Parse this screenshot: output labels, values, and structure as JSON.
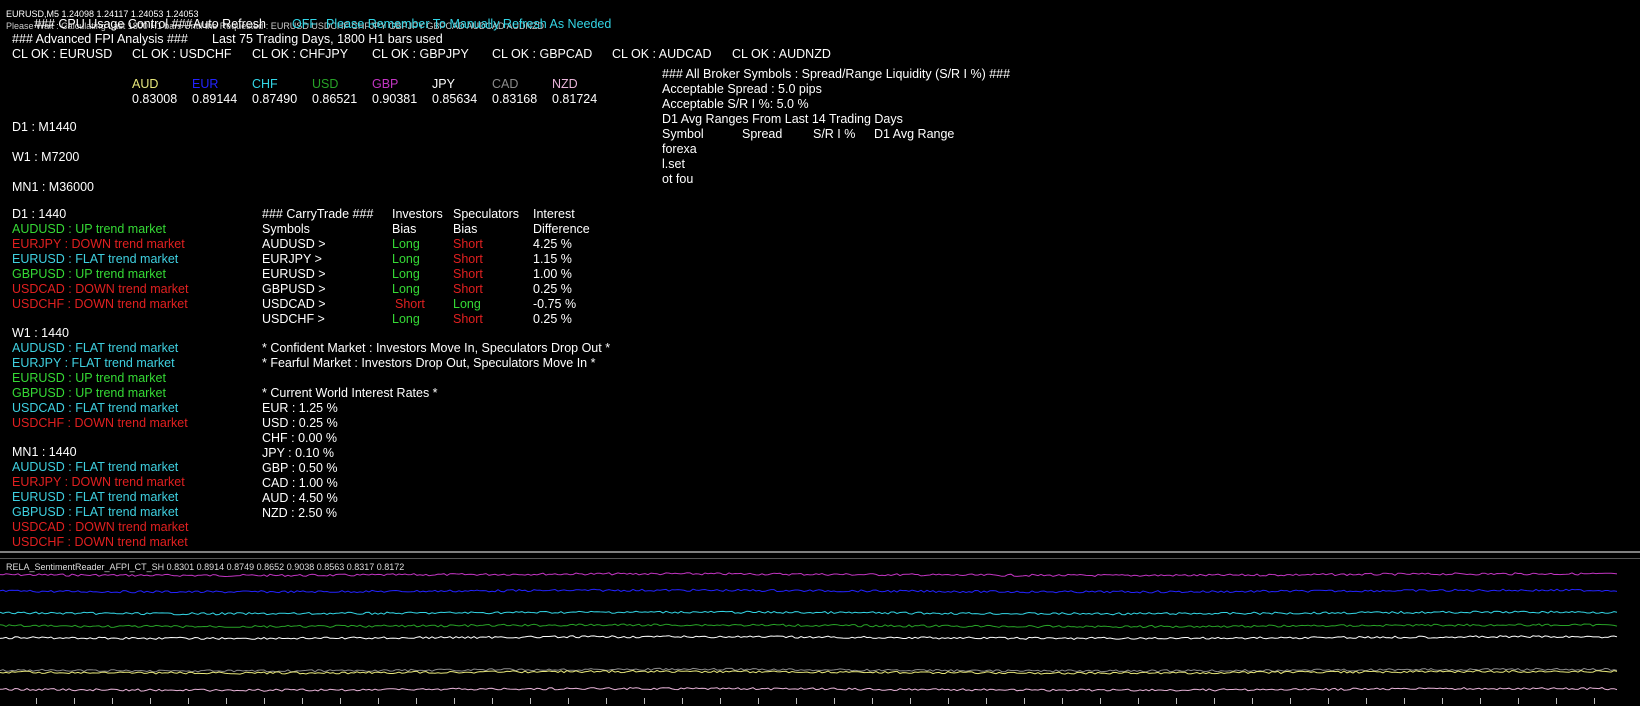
{
  "header": {
    "symbol_line": "EURUSD,M5  1.24098 1.24117 1.24053 1.24053",
    "overlap_line_1": "Please Wait : Calculating Last 1800 H1 bars Until the Requested : EURUSD USDCHF CHFJPY GBPJPY GBPCAD AUDCAD AUDNZD",
    "cpu_control": "### CPU Usage Control ###",
    "auto_refresh": "Auto Refresh",
    "refresh_state": "OFF",
    "refresh_note": "Please Remember To Manually Refresh As Needed"
  },
  "analysis": {
    "title": "### Advanced FPI Analysis ###",
    "period_info": "Last 75 Trading Days, 1800 H1 bars used",
    "cl_checks": [
      "CL OK : EURUSD",
      "CL OK : USDCHF",
      "CL OK : CHFJPY",
      "CL OK : GBPJPY",
      "CL OK : GBPCAD",
      "CL OK : AUDCAD",
      "CL OK : AUDNZD"
    ]
  },
  "currencies": [
    {
      "code": "AUD",
      "value": "0.83008",
      "color": "#e8e87a"
    },
    {
      "code": "EUR",
      "value": "0.89144",
      "color": "#2323ff"
    },
    {
      "code": "CHF",
      "value": "0.87490",
      "color": "#33d6e6"
    },
    {
      "code": "USD",
      "value": "0.86521",
      "color": "#27a327"
    },
    {
      "code": "GBP",
      "value": "0.90381",
      "color": "#c335c3"
    },
    {
      "code": "JPY",
      "value": "0.85634",
      "color": "#ffffff"
    },
    {
      "code": "CAD",
      "value": "0.83168",
      "color": "#8c8c8c"
    },
    {
      "code": "NZD",
      "value": "0.81724",
      "color": "#e9b4d9"
    }
  ],
  "timeframes": [
    "D1 : M1440",
    "W1 : M7200",
    "MN1 : M36000"
  ],
  "trends": [
    {
      "header": "D1 : 1440",
      "items": [
        {
          "text": "AUDUSD : UP trend market",
          "dir": "up"
        },
        {
          "text": "EURJPY : DOWN trend market",
          "dir": "down"
        },
        {
          "text": "EURUSD : FLAT trend market",
          "dir": "flat"
        },
        {
          "text": "GBPUSD : UP trend market",
          "dir": "up"
        },
        {
          "text": "USDCAD : DOWN trend market",
          "dir": "down"
        },
        {
          "text": "USDCHF : DOWN trend market",
          "dir": "down"
        }
      ]
    },
    {
      "header": "W1 : 1440",
      "items": [
        {
          "text": "AUDUSD : FLAT trend market",
          "dir": "flat"
        },
        {
          "text": "EURJPY : FLAT trend market",
          "dir": "flat"
        },
        {
          "text": "EURUSD : UP trend market",
          "dir": "up"
        },
        {
          "text": "GBPUSD : UP trend market",
          "dir": "up"
        },
        {
          "text": "USDCAD : FLAT trend market",
          "dir": "flat"
        },
        {
          "text": "USDCHF : DOWN trend market",
          "dir": "down"
        }
      ]
    },
    {
      "header": "MN1 : 1440",
      "items": [
        {
          "text": "AUDUSD : FLAT trend market",
          "dir": "flat"
        },
        {
          "text": "EURJPY : DOWN trend market",
          "dir": "down"
        },
        {
          "text": "EURUSD : FLAT trend market",
          "dir": "flat"
        },
        {
          "text": "GBPUSD : FLAT trend market",
          "dir": "flat"
        },
        {
          "text": "USDCAD : DOWN trend market",
          "dir": "down"
        },
        {
          "text": "USDCHF : DOWN trend market",
          "dir": "down"
        }
      ]
    }
  ],
  "trend_colors": {
    "up": "#35d935",
    "down": "#e02020",
    "flat": "#3fd0e0"
  },
  "carry_trade": {
    "title": "### CarryTrade ###",
    "sub_symbols": "Symbols",
    "col_investors": "Investors",
    "col_investors_2": "Bias",
    "col_speculators": "Speculators",
    "col_speculators_2": "Bias",
    "col_interest": "Interest",
    "col_interest_2": "Difference",
    "rows": [
      {
        "symbol": "AUDUSD >",
        "investors": "Long",
        "speculators": "Short",
        "diff": "4.25 %"
      },
      {
        "symbol": "EURJPY >",
        "investors": "Long",
        "speculators": "Short",
        "diff": "1.15 %"
      },
      {
        "symbol": "EURUSD >",
        "investors": "Long",
        "speculators": "Short",
        "diff": "1.00 %"
      },
      {
        "symbol": "GBPUSD >",
        "investors": "Long",
        "speculators": "Short",
        "diff": "0.25 %"
      },
      {
        "symbol": "USDCAD >",
        "investors": "Short",
        "speculators": "Long",
        "diff": "-0.75 %"
      },
      {
        "symbol": "USDCHF >",
        "investors": "Long",
        "speculators": "Short",
        "diff": "0.25 %"
      }
    ],
    "bias_colors": {
      "Long": "#35d935",
      "Short": "#e02020"
    },
    "notes": [
      "* Confident Market : Investors Move In, Speculators Drop Out *",
      "* Fearful Market : Investors Drop Out, Speculators Move In *"
    ]
  },
  "interest_rates": {
    "title": "* Current World Interest Rates *",
    "rates": [
      "EUR : 1.25 %",
      "USD : 0.25 %",
      "CHF : 0.00 %",
      "JPY : 0.10 %",
      "GBP : 0.50 %",
      "CAD : 1.00 %",
      "AUD : 4.50 %",
      "NZD : 2.50 %"
    ]
  },
  "broker": {
    "title": "### All Broker Symbols : Spread/Range Liquidity (S/R I %) ###",
    "spread": "Acceptable Spread : 5.0 pips",
    "sr": "Acceptable S/R I %: 5.0 %",
    "ranges": "D1 Avg Ranges From Last 14 Trading Days",
    "col_symbol": "Symbol",
    "col_spread": "Spread",
    "col_sr": "S/R I %",
    "col_range": "D1 Avg Range",
    "rows": [
      "forexa",
      "l.set",
      "ot fou"
    ]
  },
  "indicator": {
    "label": "RELA_SentimentReader_AFPI_CT_SH 0.8301 0.8914 0.8749 0.8652 0.9038 0.8563 0.8317 0.8172",
    "lines": [
      {
        "name": "GBP",
        "level": 0.9038,
        "color": "#c335c3"
      },
      {
        "name": "EUR",
        "level": 0.8914,
        "color": "#2323ff"
      },
      {
        "name": "CHF",
        "level": 0.8749,
        "color": "#33d6e6"
      },
      {
        "name": "USD",
        "level": 0.8652,
        "color": "#27a327"
      },
      {
        "name": "JPY",
        "level": 0.8563,
        "color": "#ffffff"
      },
      {
        "name": "CAD",
        "level": 0.8317,
        "color": "#8c8c8c"
      },
      {
        "name": "AUD",
        "level": 0.8301,
        "color": "#e8e87a"
      },
      {
        "name": "NZD",
        "level": 0.8172,
        "color": "#e9b4d9"
      }
    ]
  }
}
